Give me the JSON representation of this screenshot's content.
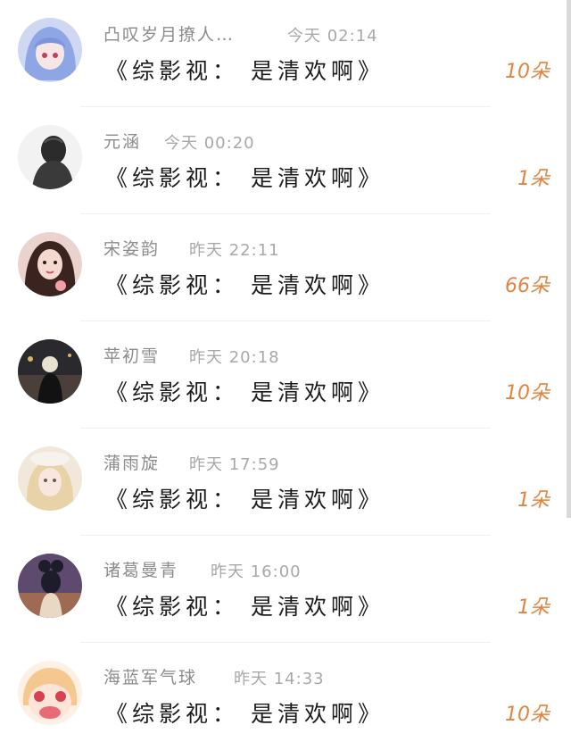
{
  "gift_list": {
    "items": [
      {
        "name": "凸叹岁月撩人…",
        "time": "今天 02:14",
        "title": "《综影视： 是清欢啊》",
        "count": "10朵",
        "avatar": "anime-girl-blue-hair-avatar"
      },
      {
        "name": "元涵",
        "time": "今天 00:20",
        "title": "《综影视： 是清欢啊》",
        "count": "1朵",
        "avatar": "person-back-sketch-avatar"
      },
      {
        "name": "宋姿韵",
        "time": "昨天 22:11",
        "title": "《综影视： 是清欢啊》",
        "count": "66朵",
        "avatar": "girl-portrait-avatar"
      },
      {
        "name": "苹初雪",
        "time": "昨天 20:18",
        "title": "《综影视： 是清欢啊》",
        "count": "10朵",
        "avatar": "night-city-person-avatar"
      },
      {
        "name": "蒲雨旋",
        "time": "昨天 17:59",
        "title": "《综影视： 是清欢啊》",
        "count": "1朵",
        "avatar": "blonde-girl-hat-avatar"
      },
      {
        "name": "诸葛曼青",
        "time": "昨天 16:00",
        "title": "《综影视： 是清欢啊》",
        "count": "1朵",
        "avatar": "dark-hair-girl-avatar"
      },
      {
        "name": "海蓝军气球",
        "time": "昨天 14:33",
        "title": "《综影视： 是清欢啊》",
        "count": "10朵",
        "avatar": "crying-anime-girl-avatar"
      }
    ]
  },
  "colors": {
    "count": "#e2843d",
    "name": "#8c8c8c",
    "title": "#1c1c1c"
  }
}
